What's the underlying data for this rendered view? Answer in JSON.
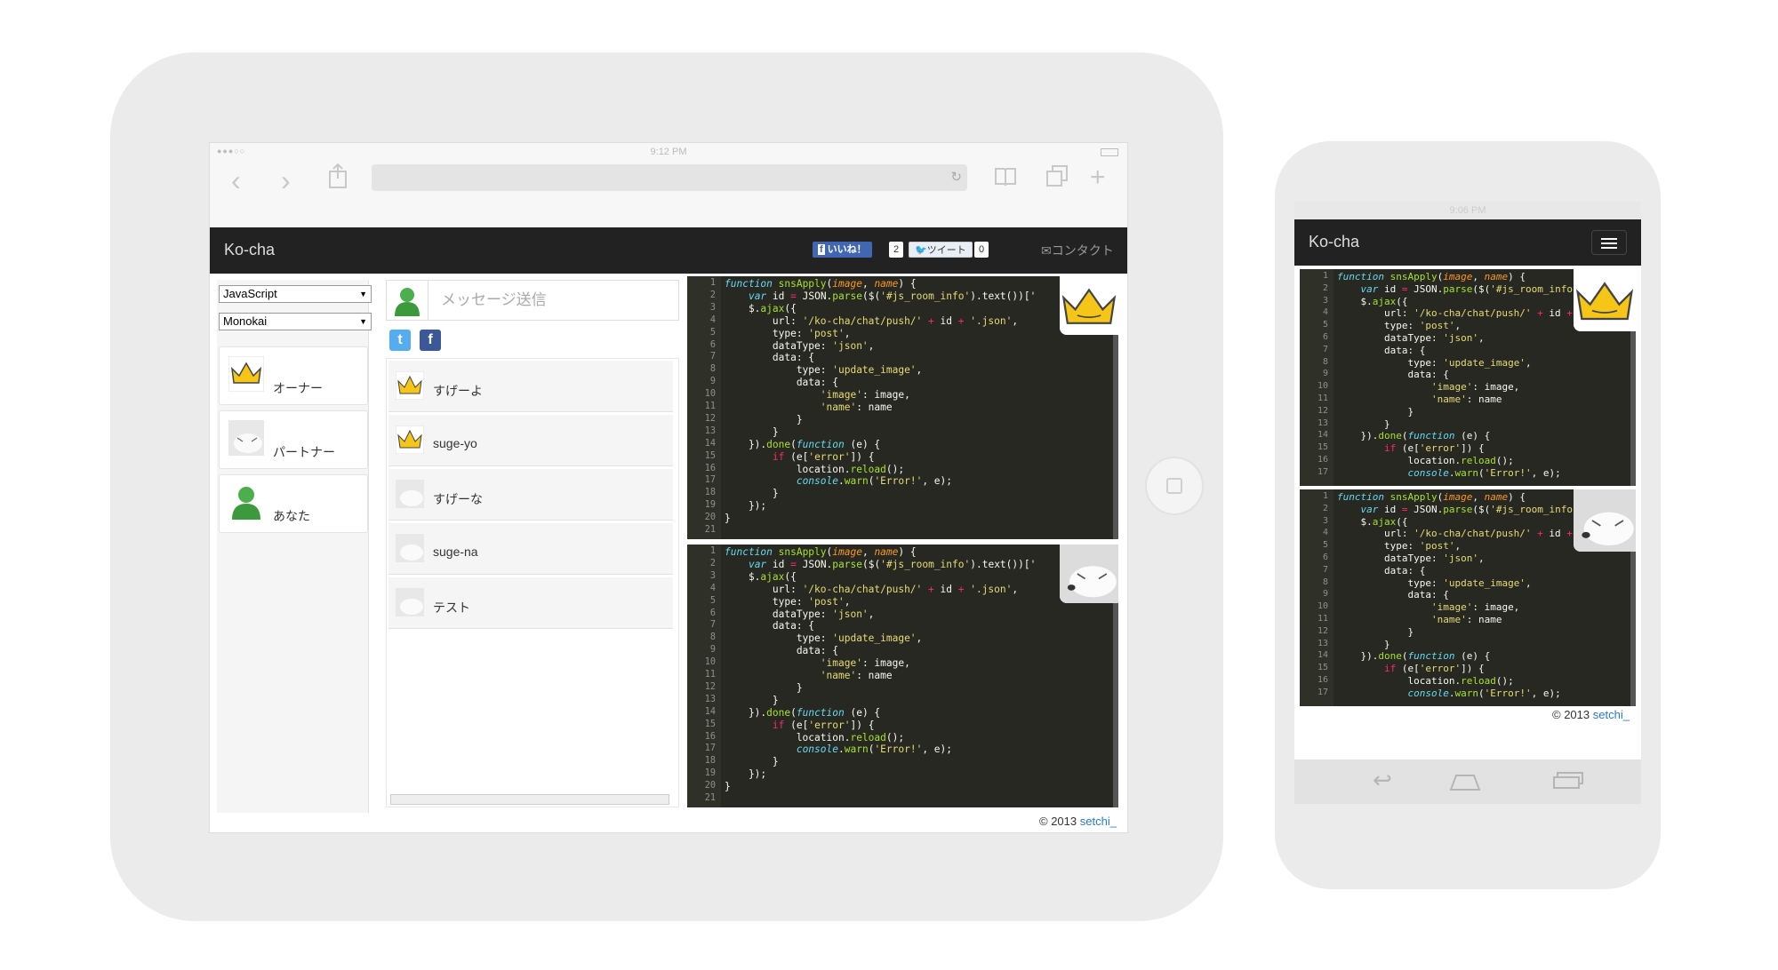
{
  "tablet": {
    "status": {
      "signal": "●●●○○",
      "time": "9:12 PM"
    },
    "nav": {
      "brand": "Ko-cha",
      "fb_like": "いいね！",
      "fb_count": "2",
      "tweet": "ツイート",
      "tweet_count": "0",
      "contact": "コンタクト"
    },
    "sidebar": {
      "language": "JavaScript",
      "theme": "Monokai",
      "users": [
        {
          "name": "オーナー",
          "avatar": "crown"
        },
        {
          "name": "パートナー",
          "avatar": "fox"
        },
        {
          "name": "あなた",
          "avatar": "person"
        }
      ]
    },
    "chat": {
      "placeholder": "メッセージ送信",
      "messages": [
        {
          "text": "すげーよ",
          "avatar": "crown"
        },
        {
          "text": "suge-yo",
          "avatar": "crown"
        },
        {
          "text": "すげーな",
          "avatar": "fox"
        },
        {
          "text": "suge-na",
          "avatar": "fox"
        },
        {
          "text": "テスト",
          "avatar": "fox"
        }
      ]
    },
    "footer": {
      "copyright": "© 2013",
      "author": "setchi_"
    }
  },
  "phone": {
    "status": {
      "time": "9:06 PM"
    },
    "nav": {
      "brand": "Ko-cha"
    },
    "footer": {
      "copyright": "© 2013",
      "author": "setchi_"
    }
  },
  "code_lines": [
    [
      [
        "k",
        "function"
      ],
      [
        "f",
        " snsApply"
      ],
      [
        "t",
        "("
      ],
      [
        "p",
        "image"
      ],
      [
        "t",
        ", "
      ],
      [
        "p",
        "name"
      ],
      [
        "t",
        ") {"
      ]
    ],
    [
      [
        "t",
        "    "
      ],
      [
        "k",
        "var"
      ],
      [
        "t",
        " id "
      ],
      [
        "r",
        "="
      ],
      [
        "t",
        " JSON."
      ],
      [
        "f",
        "parse"
      ],
      [
        "t",
        "($("
      ],
      [
        "s",
        "'#js_room_info'"
      ],
      [
        "t",
        ").text())['"
      ]
    ],
    [
      [
        "t",
        "    $."
      ],
      [
        "f",
        "ajax"
      ],
      [
        "t",
        "({"
      ]
    ],
    [
      [
        "t",
        "        url: "
      ],
      [
        "s",
        "'/ko-cha/chat/push/'"
      ],
      [
        "r",
        " + "
      ],
      [
        "t",
        "id "
      ],
      [
        "r",
        "+"
      ],
      [
        "s",
        " '.json'"
      ],
      [
        "t",
        ","
      ]
    ],
    [
      [
        "t",
        "        type: "
      ],
      [
        "s",
        "'post'"
      ],
      [
        "t",
        ","
      ]
    ],
    [
      [
        "t",
        "        dataType: "
      ],
      [
        "s",
        "'json'"
      ],
      [
        "t",
        ","
      ]
    ],
    [
      [
        "t",
        "        data: {"
      ]
    ],
    [
      [
        "t",
        "            type: "
      ],
      [
        "s",
        "'update_image'"
      ],
      [
        "t",
        ","
      ]
    ],
    [
      [
        "t",
        "            data: {"
      ]
    ],
    [
      [
        "t",
        "                "
      ],
      [
        "s",
        "'image'"
      ],
      [
        "t",
        ": image,"
      ]
    ],
    [
      [
        "t",
        "                "
      ],
      [
        "s",
        "'name'"
      ],
      [
        "t",
        ": name"
      ]
    ],
    [
      [
        "t",
        "            }"
      ]
    ],
    [
      [
        "t",
        "        }"
      ]
    ],
    [
      [
        "t",
        "    })."
      ],
      [
        "f",
        "done"
      ],
      [
        "t",
        "("
      ],
      [
        "k",
        "function"
      ],
      [
        "t",
        " (e) {"
      ]
    ],
    [
      [
        "t",
        "        "
      ],
      [
        "r",
        "if"
      ],
      [
        "t",
        " (e["
      ],
      [
        "s",
        "'error'"
      ],
      [
        "t",
        "]) {"
      ]
    ],
    [
      [
        "t",
        "            location."
      ],
      [
        "f",
        "reload"
      ],
      [
        "t",
        "();"
      ]
    ],
    [
      [
        "t",
        "            "
      ],
      [
        "k",
        "console"
      ],
      [
        "t",
        "."
      ],
      [
        "f",
        "warn"
      ],
      [
        "t",
        "("
      ],
      [
        "s",
        "'Error!'"
      ],
      [
        "t",
        ", e);"
      ]
    ],
    [
      [
        "t",
        "        }"
      ]
    ],
    [
      [
        "t",
        "    });"
      ]
    ],
    [
      [
        "t",
        "}"
      ]
    ],
    [
      [
        "t",
        ""
      ]
    ]
  ],
  "colors": {
    "navbar": "#222222",
    "editor_bg": "#272822",
    "link": "#2a7ac0",
    "facebook": "#3b5998",
    "twitter": "#55acee"
  }
}
